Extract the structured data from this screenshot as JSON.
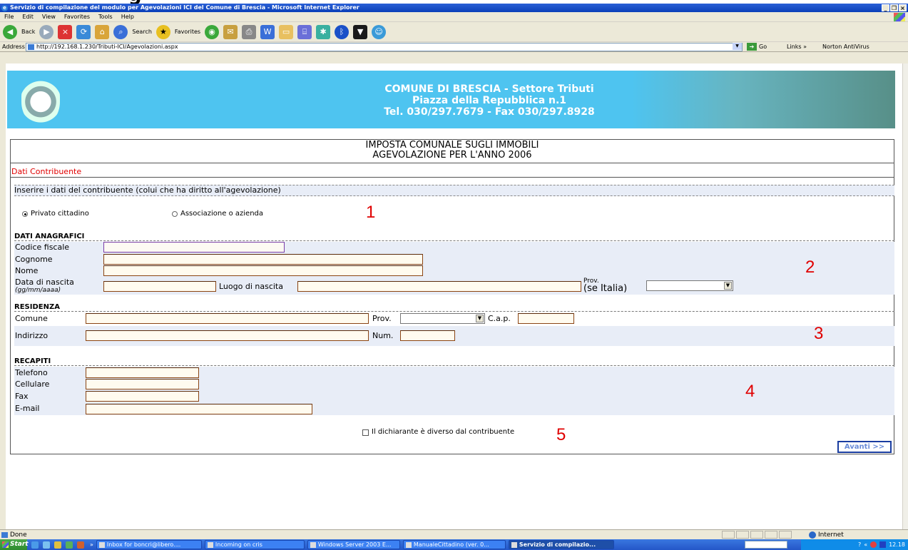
{
  "slide_fragment": "g",
  "window": {
    "title": "Servizio di compilazione del modulo per Agevolazioni ICI del Comune di Brescia - Microsoft Internet Explorer",
    "controls": [
      "_",
      "&#x1f5d7;",
      "×"
    ]
  },
  "menu": [
    "File",
    "Edit",
    "View",
    "Favorites",
    "Tools",
    "Help"
  ],
  "toolbar": {
    "back": "Back",
    "search": "Search",
    "favorites": "Favorites"
  },
  "address": {
    "label": "Address",
    "url": "http://192.168.1.230/Tributi-ICI/Agevolazioni.aspx",
    "go": "Go",
    "links": "Links »",
    "norton": "Norton AntiVirus"
  },
  "banner": {
    "line1": "COMUNE DI BRESCIA - Settore Tributi",
    "line2": "Piazza della Repubblica n.1",
    "line3": "Tel. 030/297.7679 - Fax 030/297.8928"
  },
  "form": {
    "header1": "IMPOSTA COMUNALE SUGLI IMMOBILI",
    "header2": "AGEVOLAZIONE PER L'ANNO 2006",
    "section_title": "Dati Contribuente",
    "intro": "Inserire i dati del contribuente (colui che ha diritto all'agevolazione)",
    "radio_privato": "Privato cittadino",
    "radio_associazione": "Associazione o azienda",
    "anagrafici": {
      "title": "DATI ANAGRAFICI",
      "codice_fiscale": "Codice fiscale",
      "cognome": "Cognome",
      "nome": "Nome",
      "data_nascita": "Data di nascita",
      "data_hint": "(gg/mm/aaaa)",
      "luogo_nascita": "Luogo di nascita",
      "prov": "Prov.",
      "prov_hint": "(se Italia)"
    },
    "residenza": {
      "title": "RESIDENZA",
      "comune": "Comune",
      "prov": "Prov.",
      "cap": "C.a.p.",
      "indirizzo": "Indirizzo",
      "num": "Num."
    },
    "recapiti": {
      "title": "RECAPITI",
      "telefono": "Telefono",
      "cellulare": "Cellulare",
      "fax": "Fax",
      "email": "E-mail"
    },
    "checkbox_dichiarante": "Il dichiarante è diverso dal contribuente",
    "avanti": "Avanti >>"
  },
  "annotations": [
    "1",
    "2",
    "3",
    "4",
    "5"
  ],
  "status": {
    "text": "Done",
    "zone": "Internet"
  },
  "taskbar": {
    "start": "Start",
    "tasks": [
      "Inbox for boncri@libero....",
      "Incoming on cris",
      "Windows Server 2003 E...",
      "ManualeCittadino (ver. 0...",
      "Servizio di compilazio..."
    ],
    "clock": "12.18"
  }
}
